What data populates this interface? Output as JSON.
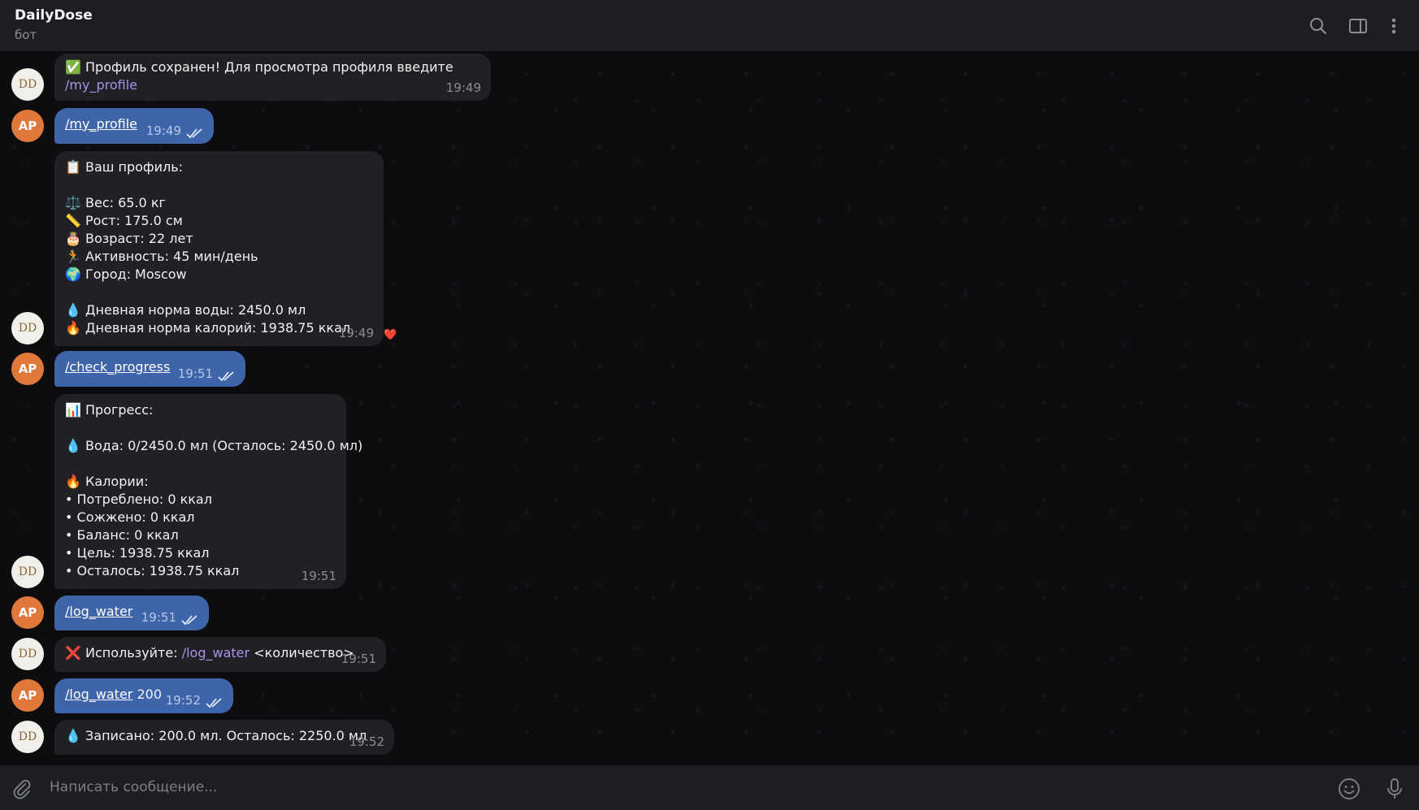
{
  "header": {
    "title": "DailyDose",
    "subtitle": "бот",
    "icons": [
      "search-icon",
      "sidebar-toggle-icon",
      "more-vertical-icon"
    ]
  },
  "avatars": {
    "bot_initials": "DD",
    "user_initials": "AP"
  },
  "messages": [
    {
      "from": "bot",
      "lines": [
        "✅ Профиль сохранен! Для просмотра профиля введите"
      ],
      "link": "/my_profile",
      "time": "19:49"
    },
    {
      "from": "user",
      "command": "/my_profile",
      "time": "19:49"
    },
    {
      "from": "bot",
      "lines": [
        "📋 Ваш профиль:",
        "",
        "⚖️ Вес: 65.0 кг",
        "📏 Рост: 175.0 см",
        "🎂 Возраст: 22 лет",
        "🏃 Активность: 45 мин/день",
        "🌍 Город: Moscow",
        "",
        "💧 Дневная норма воды: 2450.0 мл",
        "🔥 Дневная норма калорий: 1938.75 ккал"
      ],
      "time": "19:49",
      "reaction": "❤️"
    },
    {
      "from": "user",
      "command": "/check_progress",
      "time": "19:51"
    },
    {
      "from": "bot",
      "lines": [
        "📊 Прогресс:",
        "",
        "💧 Вода: 0/2450.0 мл (Осталось: 2450.0 мл)",
        "",
        "🔥 Калории:",
        "• Потреблено: 0 ккал",
        "• Сожжено: 0 ккал",
        "• Баланс: 0 ккал",
        "• Цель: 1938.75 ккал",
        "• Осталось: 1938.75 ккал"
      ],
      "time": "19:51"
    },
    {
      "from": "user",
      "command": "/log_water",
      "time": "19:51"
    },
    {
      "from": "bot",
      "prefix": "❌ Используйте: ",
      "link": "/log_water",
      "suffix": " <количество>",
      "time": "19:51"
    },
    {
      "from": "user",
      "command": "/log_water",
      "suffix": " 200",
      "time": "19:52"
    },
    {
      "from": "bot",
      "lines": [
        "💧 Записано: 200.0 мл. Осталось: 2250.0 мл"
      ],
      "time": "19:52"
    }
  ],
  "composer": {
    "placeholder": "Написать сообщение...",
    "icons": [
      "attach-icon",
      "emoji-icon",
      "microphone-icon"
    ]
  },
  "colors": {
    "incoming_bubble": "#212125",
    "outgoing_bubble": "#3e64aa",
    "link": "#a892e8",
    "user_avatar": "#e0783b"
  }
}
